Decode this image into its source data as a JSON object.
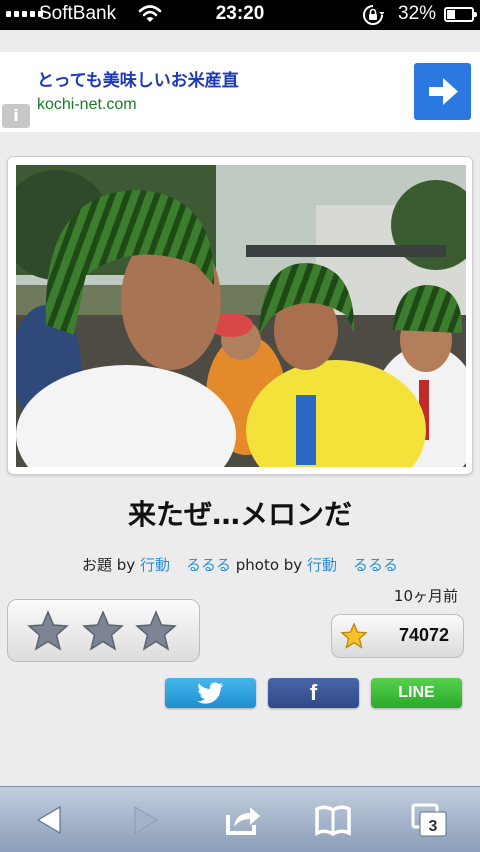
{
  "status": {
    "carrier": "SoftBank",
    "time": "23:20",
    "battery_pct": "32%",
    "battery_level": 0.32
  },
  "ad": {
    "title": "とっても美味しいお米産直",
    "url": "kochi-net.com",
    "info_label": "i"
  },
  "post": {
    "caption": "来たぜ…メロンだ",
    "credit": {
      "prefix": "お題 by",
      "topic_author": "行動",
      "topic_author2": "るるる",
      "photo_label": "photo by",
      "photo_author": "行動",
      "photo_author2": "るるる"
    },
    "time_ago": "10ヶ月前",
    "rating_stars": 3,
    "score": "74072"
  },
  "share": {
    "twitter_icon": "twitter-bird-icon",
    "facebook_label": "f",
    "line_label": "LINE"
  },
  "toolbar": {
    "tabs_count": "3"
  },
  "colors": {
    "link": "#2a8fd6",
    "ad_title": "#1b39b8",
    "ad_url": "#1a7a26",
    "twitter": "#1d8fcf",
    "facebook": "#3b5998",
    "line": "#2aa82a"
  }
}
